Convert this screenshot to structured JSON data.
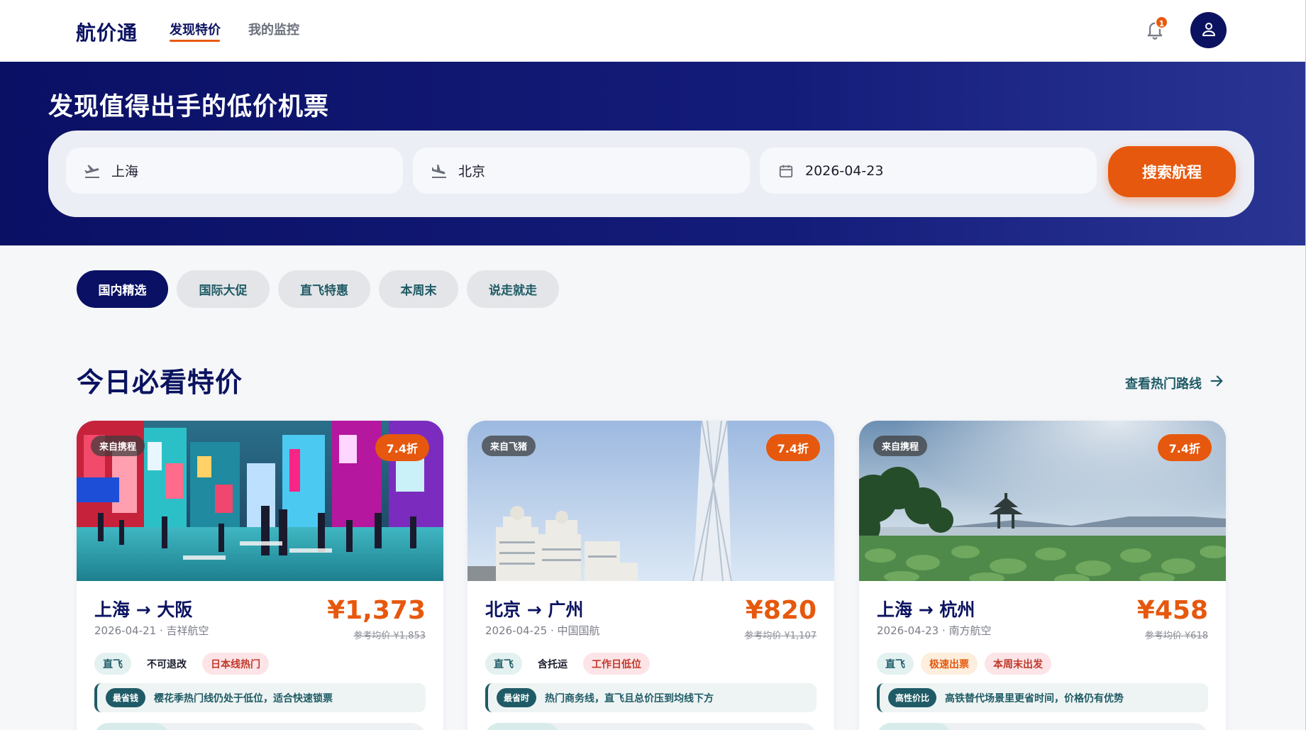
{
  "app": {
    "logo": "航价通"
  },
  "nav": {
    "items": [
      {
        "label": "发现特价",
        "active": true
      },
      {
        "label": "我的监控",
        "active": false
      }
    ]
  },
  "notifications": {
    "count": "1"
  },
  "hero": {
    "title": "发现值得出手的低价机票"
  },
  "search": {
    "from": "上海",
    "to": "北京",
    "date": "2026-04-23",
    "button": "搜索航程"
  },
  "filters": [
    {
      "label": "国内精选",
      "active": true
    },
    {
      "label": "国际大促",
      "active": false
    },
    {
      "label": "直飞特惠",
      "active": false
    },
    {
      "label": "本周末",
      "active": false
    },
    {
      "label": "说走就走",
      "active": false
    }
  ],
  "section": {
    "title": "今日必看特价",
    "see_all": "查看热门路线"
  },
  "deals": [
    {
      "source": "来自携程",
      "discount": "7.4折",
      "route": "上海 → 大阪",
      "meta": "2026-04-21 · 吉祥航空",
      "price": "¥1,373",
      "ref_price": "参考均价 ¥1,853",
      "tags": [
        {
          "label": "直飞",
          "style": "teal"
        },
        {
          "label": "不可退改",
          "style": "plain"
        },
        {
          "label": "日本线热门",
          "style": "pink"
        }
      ],
      "insight_badge": "最省钱",
      "insight": "樱花季热门线仍处于低位，适合快速锁票"
    },
    {
      "source": "来自飞猪",
      "discount": "7.4折",
      "route": "北京 → 广州",
      "meta": "2026-04-25 · 中国国航",
      "price": "¥820",
      "ref_price": "参考均价 ¥1,107",
      "tags": [
        {
          "label": "直飞",
          "style": "teal"
        },
        {
          "label": "含托运",
          "style": "plain"
        },
        {
          "label": "工作日低位",
          "style": "pink"
        }
      ],
      "insight_badge": "最省时",
      "insight": "热门商务线，直飞且总价压到均线下方"
    },
    {
      "source": "来自携程",
      "discount": "7.4折",
      "route": "上海 → 杭州",
      "meta": "2026-04-23 · 南方航空",
      "price": "¥458",
      "ref_price": "参考均价 ¥618",
      "tags": [
        {
          "label": "直飞",
          "style": "teal"
        },
        {
          "label": "极速出票",
          "style": "orange"
        },
        {
          "label": "本周末出发",
          "style": "pink"
        }
      ],
      "insight_badge": "高性价比",
      "insight": "高铁替代场景里更省时间，价格仍有优势"
    }
  ],
  "colors": {
    "navy": "#0b1360",
    "accent": "#e6580d",
    "teal": "#1f5b66"
  },
  "icons": {
    "notifications": "bell-icon",
    "account": "user-icon",
    "departure": "plane-takeoff-icon",
    "arrival": "plane-landing-icon",
    "date": "calendar-icon",
    "see_all": "arrow-right-icon"
  }
}
